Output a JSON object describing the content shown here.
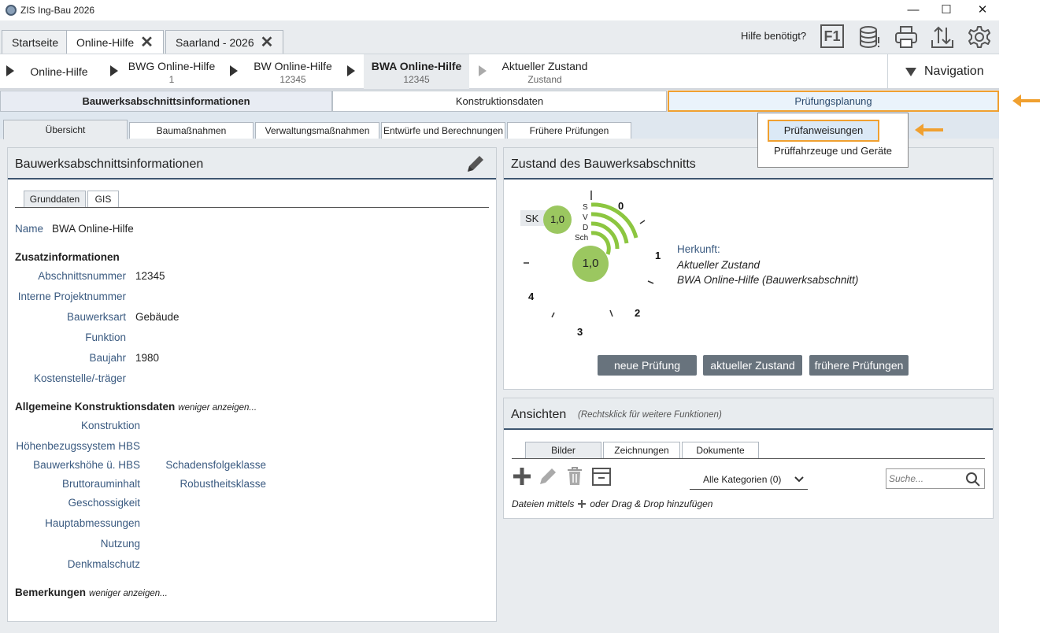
{
  "window": {
    "title": "ZIS Ing-Bau 2026",
    "min": "—",
    "max": "☐",
    "close": "✕"
  },
  "tabs": [
    {
      "label": "Startseite"
    },
    {
      "label": "Online-Hilfe",
      "close": "✕"
    },
    {
      "label": "Saarland - 2026",
      "close": "✕"
    }
  ],
  "toolbar": {
    "help_question": "Hilfe benötigt?",
    "f1": "F1"
  },
  "breadcrumb": [
    {
      "line1": "Online-Hilfe",
      "line2": ""
    },
    {
      "line1": "BWG Online-Hilfe",
      "line2": "1"
    },
    {
      "line1": "BW Online-Hilfe",
      "line2": "12345"
    },
    {
      "line1": "BWA Online-Hilfe",
      "line2": "12345"
    },
    {
      "line1": "Aktueller Zustand",
      "line2": "Zustand"
    }
  ],
  "navigation": {
    "label": "Navigation"
  },
  "main_tabs": [
    {
      "label": "Bauwerksabschnittsinformationen"
    },
    {
      "label": "Konstruktionsdaten"
    },
    {
      "label": "Prüfungsplanung"
    }
  ],
  "sub_tabs": [
    {
      "label": "Übersicht"
    },
    {
      "label": "Baumaßnahmen"
    },
    {
      "label": "Verwaltungsmaßnahmen"
    },
    {
      "label": "Entwürfe und Berechnungen"
    },
    {
      "label": "Frühere Prüfungen"
    }
  ],
  "dropdown": {
    "items": [
      {
        "label": "Prüfanweisungen"
      },
      {
        "label": "Prüffahrzeuge und Geräte"
      }
    ]
  },
  "left_panel": {
    "title": "Bauwerksabschnittsinformationen",
    "tabs": [
      {
        "label": "Grunddaten"
      },
      {
        "label": "GIS"
      }
    ],
    "name_label": "Name",
    "name_value": "BWA Online-Hilfe",
    "zusatz_title": "Zusatzinformationen",
    "zusatz": [
      {
        "label": "Abschnittsnummer",
        "value": "12345"
      },
      {
        "label": "Interne Projektnummer",
        "value": ""
      },
      {
        "label": "Bauwerksart",
        "value": "Gebäude"
      },
      {
        "label": "Funktion",
        "value": ""
      },
      {
        "label": "Baujahr",
        "value": "1980"
      },
      {
        "label": "Kostenstelle/-träger",
        "value": ""
      }
    ],
    "konstr_title": "Allgemeine Konstruktionsdaten",
    "less_label": "weniger anzeigen...",
    "konstr_left": [
      {
        "label": "Konstruktion"
      },
      {
        "label": "Höhenbezugssystem HBS"
      },
      {
        "label": "Bauwerkshöhe ü. HBS"
      },
      {
        "label": "Bruttorauminhalt"
      },
      {
        "label": "Geschossigkeit"
      },
      {
        "label": "Hauptabmessungen"
      },
      {
        "label": "Nutzung"
      },
      {
        "label": "Denkmalschutz"
      }
    ],
    "konstr_right": [
      {
        "label": "Schadensfolgeklasse"
      },
      {
        "label": "Robustheitsklasse"
      }
    ],
    "bemerkungen_title": "Bemerkungen"
  },
  "zustand_panel": {
    "title": "Zustand des Bauwerksabschnitts",
    "sk_label": "SK",
    "sk_value": "1,0",
    "main_value": "1,0",
    "categories": [
      "S",
      "V",
      "D",
      "Sch"
    ],
    "gauge_numbers": [
      "0",
      "1",
      "2",
      "3",
      "4"
    ],
    "herkunft_label": "Herkunft:",
    "herkunft_line1": "Aktueller Zustand",
    "herkunft_line2": "BWA Online-Hilfe (Bauwerksabschnitt)",
    "buttons": [
      {
        "label": "neue Prüfung"
      },
      {
        "label": "aktueller Zustand"
      },
      {
        "label": "frühere Prüfungen"
      }
    ],
    "colors": {
      "gauge": "#8cc640",
      "circle": "#9bc760"
    }
  },
  "ansichten_panel": {
    "title": "Ansichten",
    "hint": "(Rechtsklick für weitere Funktionen)",
    "tabs": [
      {
        "label": "Bilder"
      },
      {
        "label": "Zeichnungen"
      },
      {
        "label": "Dokumente"
      }
    ],
    "category_select": "Alle Kategorien (0)",
    "search_placeholder": "Suche...",
    "footer_part1": "Dateien mittels",
    "footer_part2": "oder Drag & Drop hinzufügen"
  },
  "colors": {
    "highlight": "#f0a030",
    "label_blue": "#3a5a80",
    "header_rule": "#3e5670"
  }
}
